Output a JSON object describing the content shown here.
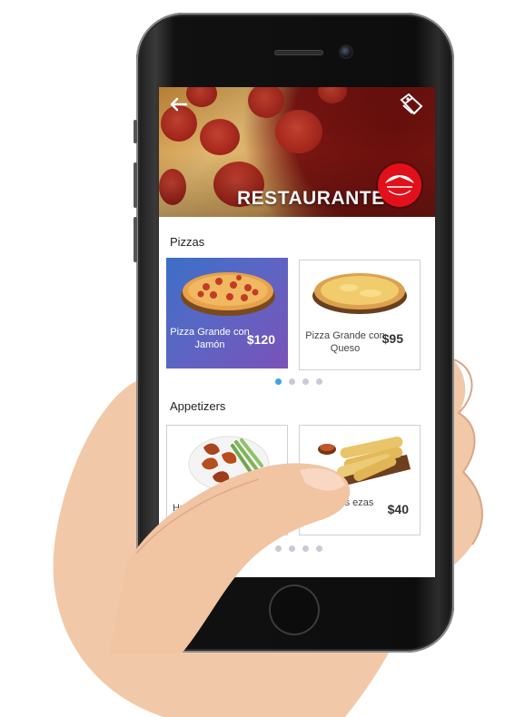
{
  "hero": {
    "title": "RESTAURANTE",
    "back_icon": "arrow-left-icon",
    "tag_icon": "tag-icon",
    "logo_text": "Pizza Hut"
  },
  "sections": [
    {
      "title": "Pizzas",
      "items": [
        {
          "name": "Pizza Grande con Jamón",
          "price": "$120",
          "selected": true
        },
        {
          "name": "Pizza Grande con Queso",
          "price": "$95",
          "selected": false
        }
      ],
      "pager": {
        "count": 4,
        "active": 0
      }
    },
    {
      "title": "Appetizers",
      "items": [
        {
          "name": "Hu",
          "price": "",
          "selected": false
        },
        {
          "name": "cks ezas",
          "price": "$40",
          "selected": false
        }
      ],
      "pager": {
        "count": 4,
        "active": 1
      }
    }
  ],
  "colors": {
    "accent_gradient_start": "#3b6fc6",
    "accent_gradient_end": "#7a52b8",
    "pager_active": "#3aa3e8",
    "pager_inactive": "#c8cbd4",
    "logo_red": "#e2101a"
  }
}
